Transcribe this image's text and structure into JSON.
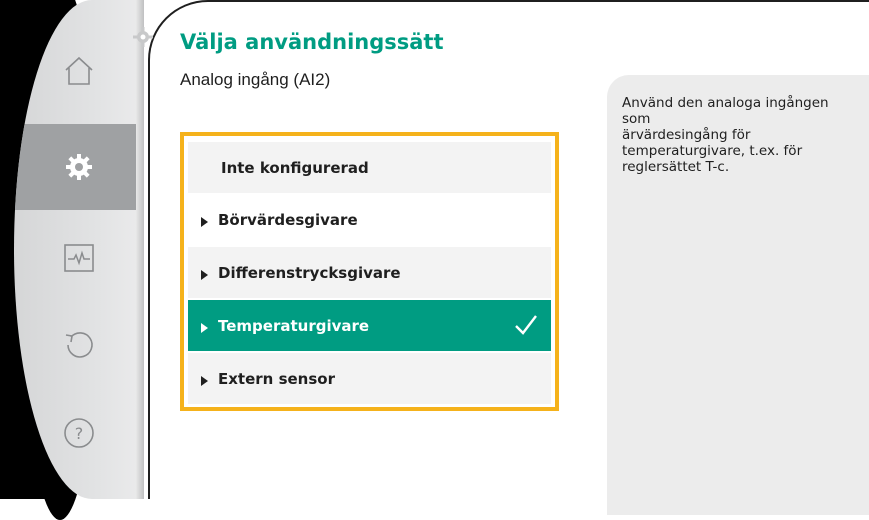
{
  "nav": {
    "items": [
      {
        "name": "home",
        "icon": "home-icon"
      },
      {
        "name": "settings",
        "icon": "gear-icon",
        "active": true
      },
      {
        "name": "diagnostics",
        "icon": "pulse-monitor-icon"
      },
      {
        "name": "undo",
        "icon": "undo-icon"
      },
      {
        "name": "help",
        "icon": "help-icon"
      }
    ]
  },
  "header": {
    "title": "Välja användningssätt",
    "subtitle": "Analog ingång (AI2)"
  },
  "options": [
    {
      "label": "Inte konfigurerad",
      "has_arrow": false,
      "selected": false
    },
    {
      "label": "Börvärdesgivare",
      "has_arrow": true,
      "selected": false
    },
    {
      "label": "Differenstrycksgivare",
      "has_arrow": true,
      "selected": false
    },
    {
      "label": "Temperaturgivare",
      "has_arrow": true,
      "selected": true
    },
    {
      "label": "Extern sensor",
      "has_arrow": true,
      "selected": false
    }
  ],
  "info": {
    "text": "Använd den analoga ingången\nsom\närvärdesingång för\ntemperaturgivare, t.ex. för\nreglersättet T-c."
  },
  "colors": {
    "accent": "#009c82",
    "focus_frame": "#f5b21b",
    "info_bg": "#ececec",
    "rail_active": "#9fa1a3"
  }
}
